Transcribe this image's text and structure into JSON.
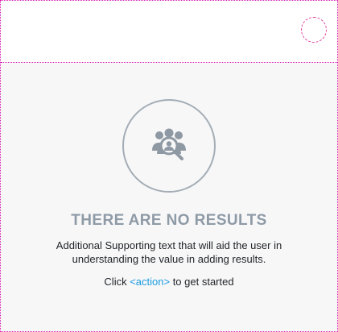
{
  "empty_state": {
    "title": "THERE ARE NO RESULTS",
    "supporting_text": "Additional Supporting text that will aid the user in understanding the value in adding results.",
    "cta_prefix": "Click ",
    "cta_link": "<action>",
    "cta_suffix": " to get started",
    "icon": "user-search-icon",
    "colors": {
      "title": "#8e9aa6",
      "link": "#1a9be0",
      "icon": "#8e99a3",
      "guide_lines": "#d81bb0"
    }
  }
}
